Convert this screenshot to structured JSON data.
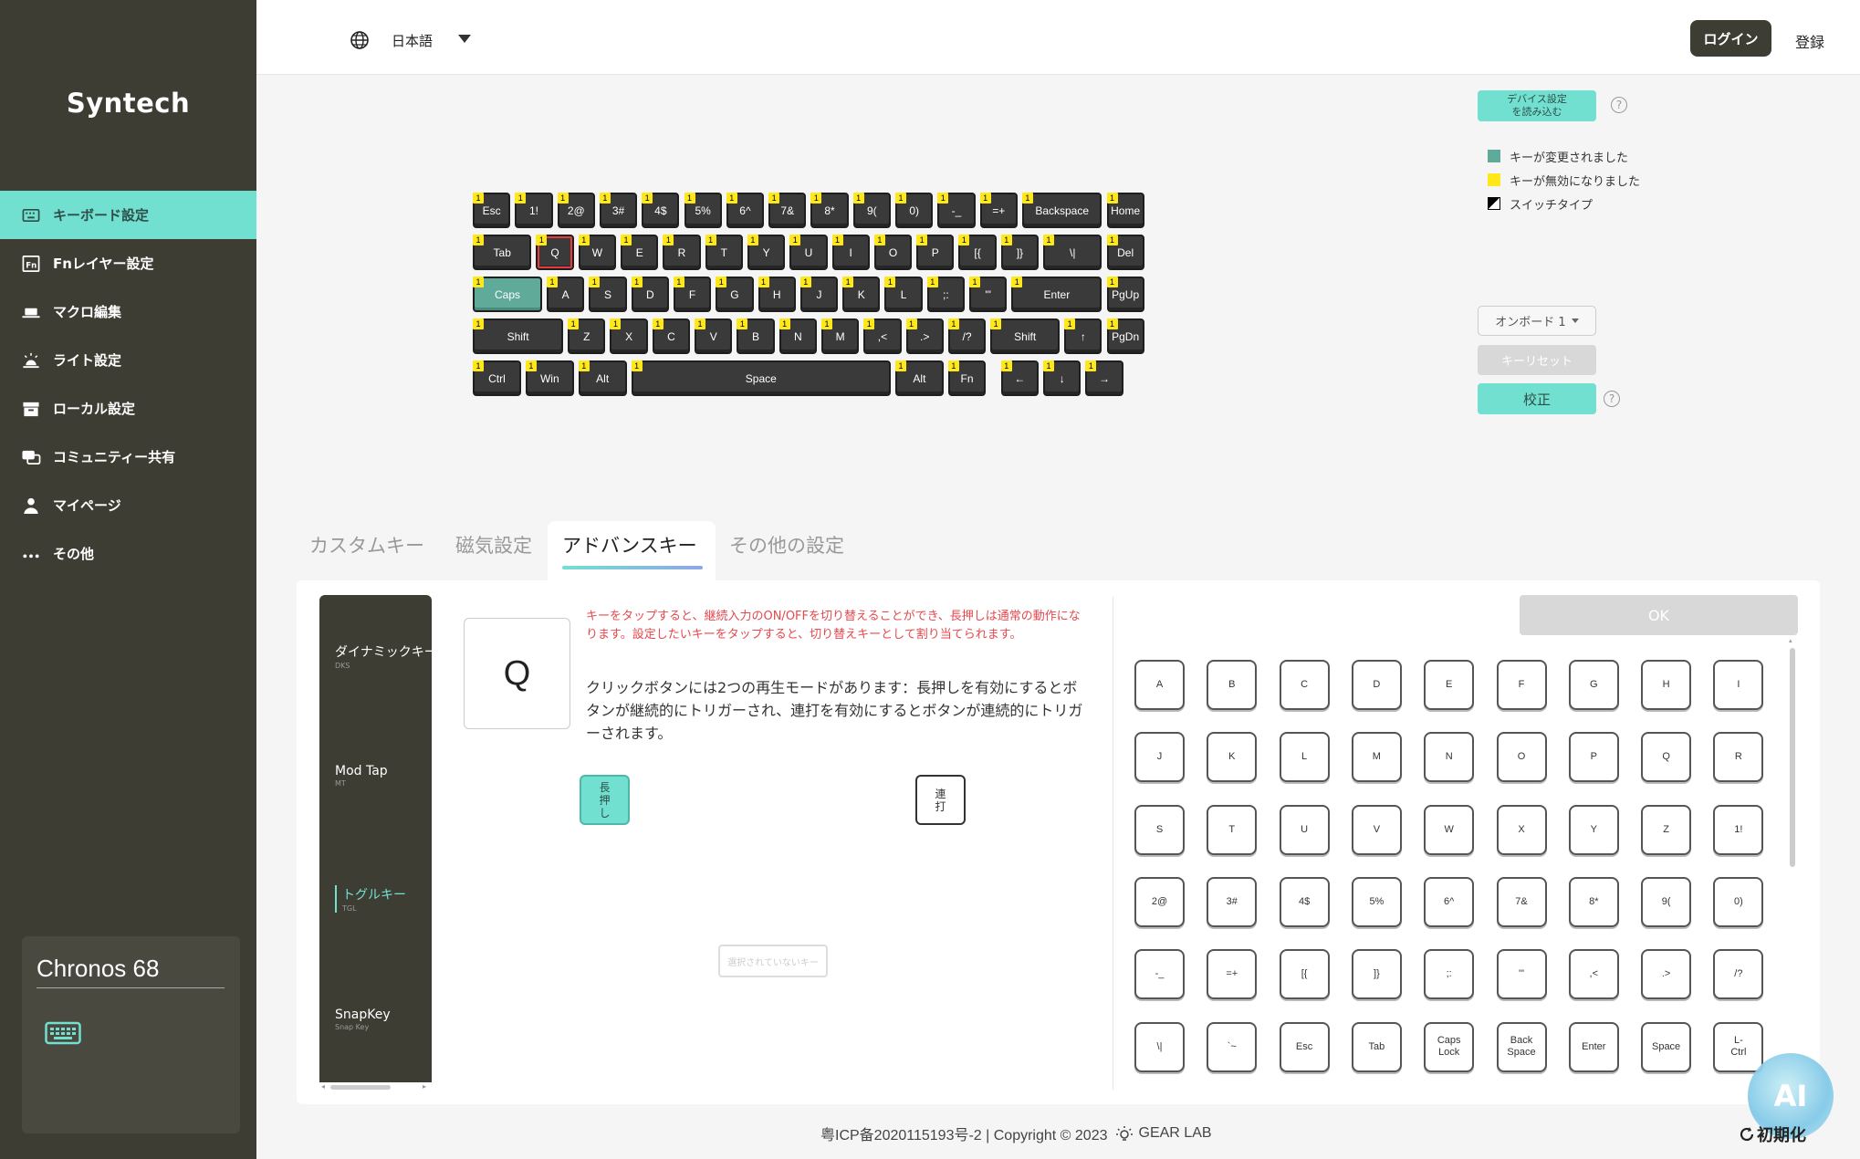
{
  "brand": "Syntech",
  "sidebar": {
    "items": [
      {
        "label": "キーボード設定",
        "icon": "keyboard-icon",
        "active": true
      },
      {
        "label": "Fnレイヤー設定",
        "icon": "fn-icon"
      },
      {
        "label": "マクロ編集",
        "icon": "macro-icon"
      },
      {
        "label": "ライト設定",
        "icon": "light-icon"
      },
      {
        "label": "ローカル設定",
        "icon": "archive-icon"
      },
      {
        "label": "コミュニティー共有",
        "icon": "chat-icon"
      },
      {
        "label": "マイページ",
        "icon": "user-icon"
      },
      {
        "label": "その他",
        "icon": "more-icon"
      }
    ]
  },
  "device": {
    "name": "Chronos 68",
    "icon": "keyboard-icon"
  },
  "header": {
    "language": "日本語",
    "login": "ログイン",
    "register": "登録"
  },
  "keyboard": {
    "layer_badge": "1",
    "selected_key": "Q",
    "rows": [
      [
        "Esc",
        "1!",
        "2@",
        "3#",
        "4$",
        "5%",
        "6^",
        "7&",
        "8*",
        "9(",
        "0)",
        "-_",
        "=+",
        "Backspace",
        "Home"
      ],
      [
        "Tab",
        "Q",
        "W",
        "E",
        "R",
        "T",
        "Y",
        "U",
        "I",
        "O",
        "P",
        "[{",
        "]}",
        "\\|",
        "Del"
      ],
      [
        "Caps",
        "A",
        "S",
        "D",
        "F",
        "G",
        "H",
        "J",
        "K",
        "L",
        ";:",
        "'\"",
        "Enter",
        "PgUp"
      ],
      [
        "Shift",
        "Z",
        "X",
        "C",
        "V",
        "B",
        "N",
        "M",
        ",<",
        ".>",
        "/?",
        "Shift",
        "↑",
        "PgDn"
      ],
      [
        "Ctrl",
        "Win",
        "Alt",
        "Space",
        "Alt",
        "Fn",
        "←",
        "↓",
        "→"
      ]
    ]
  },
  "right_panel": {
    "read_device": "デバイス設定\nを読み込む",
    "legend": [
      {
        "label": "キーが変更されました",
        "color": "#5faa98"
      },
      {
        "label": "キーが無効になりました",
        "color": "#ffe81a"
      },
      {
        "label": "スイッチタイプ",
        "color": "#000000"
      }
    ],
    "onboard": "オンボード 1",
    "key_reset": "キーリセット",
    "calibrate": "校正"
  },
  "tabs": [
    "カスタムキー",
    "磁気設定",
    "アドバンスキー",
    "その他の設定"
  ],
  "advanced": {
    "modes": [
      {
        "label": "ダイナミックキー",
        "sub": "DKS"
      },
      {
        "label": "Mod Tap",
        "sub": "MT"
      },
      {
        "label": "トグルキー",
        "sub": "TGL",
        "active": true
      },
      {
        "label": "SnapKey",
        "sub": "Snap Key"
      }
    ],
    "key": "Q",
    "red_desc": "キーをタップすると、継続入力のON/OFFを切り替えることができ、長押しは通常の動作になります。設定したいキーをタップすると、切り替えキーとして割り当てられます。",
    "desc": "クリックボタンには2つの再生モードがあります：長押しを有効にするとボタンが継続的にトリガーされ、連打を有効にするとボタンが連続的にトリガーされます。",
    "long_press": "長押し",
    "rapid": "連打",
    "unselected": "選択されていないキー",
    "ok": "OK",
    "grid": [
      "A",
      "B",
      "C",
      "D",
      "E",
      "F",
      "G",
      "H",
      "I",
      "J",
      "K",
      "L",
      "M",
      "N",
      "O",
      "P",
      "Q",
      "R",
      "S",
      "T",
      "U",
      "V",
      "W",
      "X",
      "Y",
      "Z",
      "1!",
      "2@",
      "3#",
      "4$",
      "5%",
      "6^",
      "7&",
      "8*",
      "9(",
      "0)",
      "-_",
      "=+",
      "[{",
      "]}",
      ";:",
      "'\"",
      ",<",
      ".>",
      "/?",
      "\\|",
      "`~",
      "Esc",
      "Tab",
      "Caps\nLock",
      "Back\nSpace",
      "Enter",
      "Space",
      "L-\nCtrl"
    ]
  },
  "ai_badge": "AI",
  "reset_init": "初期化",
  "footer": {
    "icp": "粤ICP备2020115193号-2 | Copyright © 2023",
    "company": "GEAR LAB"
  }
}
